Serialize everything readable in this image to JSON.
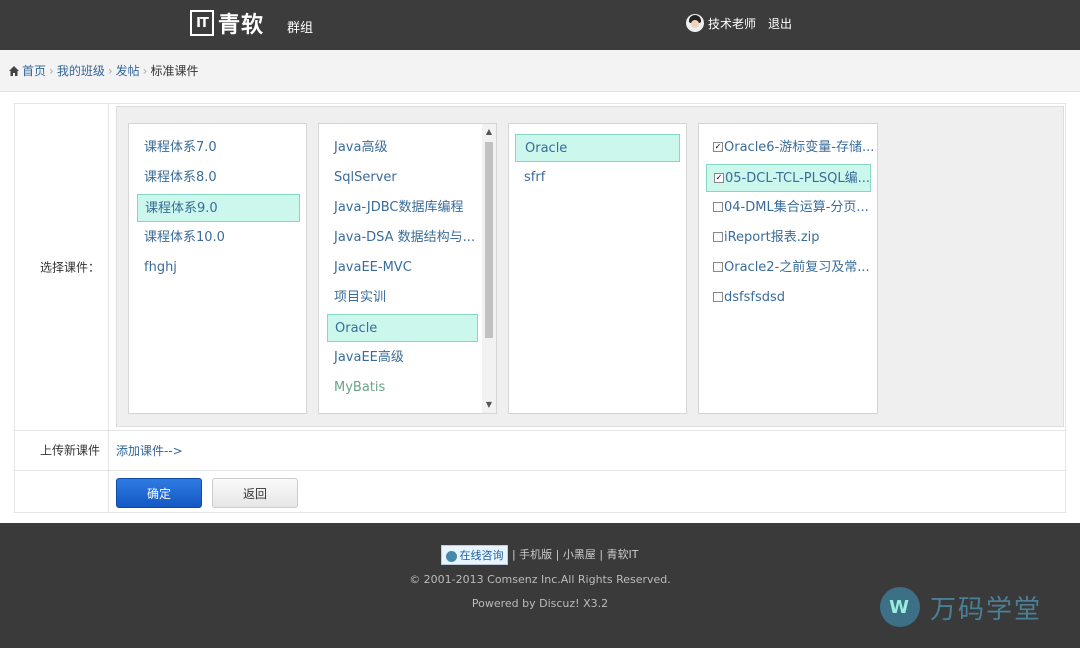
{
  "header": {
    "logo_mark": "IT",
    "logo_text": "青软",
    "nav_group": "群组",
    "user_name": "技术老师",
    "logout": "退出"
  },
  "breadcrumb": {
    "items": [
      "首页",
      "我的班级",
      "发帖"
    ],
    "current": "标准课件"
  },
  "form": {
    "select_label": "选择课件：",
    "col1": [
      "课程体系7.0",
      "课程体系8.0",
      "课程体系9.0",
      "课程体系10.0",
      "fhghj"
    ],
    "col2": [
      "Java高级",
      "SqlServer",
      "Java-JDBC数据库编程",
      "Java-DSA 数据结构与...",
      "JavaEE-MVC",
      "项目实训",
      "Oracle",
      "JavaEE高级",
      "MyBatis"
    ],
    "col3": [
      "Oracle",
      "sfrf"
    ],
    "col4": [
      "Oracle6-游标变量-存储...",
      "05-DCL-TCL-PLSQL编...",
      "04-DML集合运算-分页...",
      "iReport报表.zip",
      "Oracle2-之前复习及常...",
      "dsfsfsdsd"
    ],
    "upload_label": "上传新课件",
    "upload_link": "添加课件-->",
    "ok_button": "确定",
    "back_button": "返回"
  },
  "footer": {
    "consult": "在线咨询",
    "links": "| 手机版 | 小黑屋 | 青软IT",
    "copyright": "© 2001-2013 Comsenz Inc.All Rights Reserved.",
    "powered": "Powered by Discuz! X3.2"
  },
  "watermark": {
    "text": "万码学堂"
  }
}
